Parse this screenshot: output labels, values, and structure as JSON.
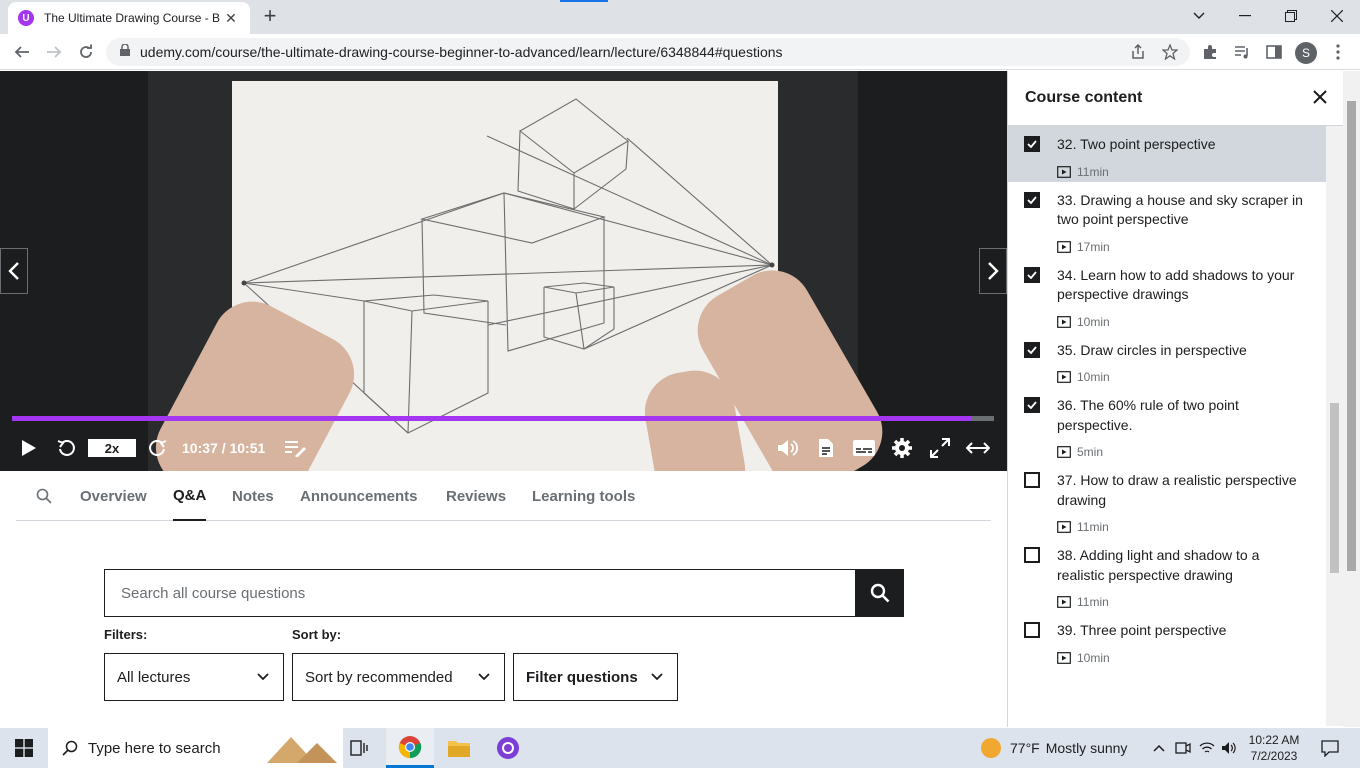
{
  "browser": {
    "tab_title": "The Ultimate Drawing Course - B",
    "url": "udemy.com/course/the-ultimate-drawing-course-beginner-to-advanced/learn/lecture/6348844#questions",
    "avatar_letter": "S",
    "favicon_letter": "U"
  },
  "player": {
    "speed": "2x",
    "time": "10:37 / 10:51",
    "progress": 0.977,
    "accent": "#a435f0"
  },
  "tabs": [
    "Overview",
    "Q&A",
    "Notes",
    "Announcements",
    "Reviews",
    "Learning tools"
  ],
  "active_tab": "Q&A",
  "qa": {
    "search_placeholder": "Search all course questions",
    "filters_label": "Filters:",
    "sort_label": "Sort by:",
    "filter_value": "All lectures",
    "sort_value": "Sort by recommended",
    "filter_questions": "Filter questions"
  },
  "sidebar": {
    "title": "Course content",
    "lectures": [
      {
        "title": "32. Two point perspective",
        "duration": "11min",
        "checked": true,
        "current": true
      },
      {
        "title": "33. Drawing a house and sky scraper in two point perspective",
        "duration": "17min",
        "checked": true,
        "current": false
      },
      {
        "title": "34. Learn how to add shadows to your perspective drawings",
        "duration": "10min",
        "checked": true,
        "current": false
      },
      {
        "title": "35. Draw circles in perspective",
        "duration": "10min",
        "checked": true,
        "current": false
      },
      {
        "title": "36. The 60% rule of two point perspective.",
        "duration": "5min",
        "checked": true,
        "current": false
      },
      {
        "title": "37. How to draw a realistic perspective drawing",
        "duration": "11min",
        "checked": false,
        "current": false
      },
      {
        "title": "38. Adding light and shadow to a realistic perspective drawing",
        "duration": "11min",
        "checked": false,
        "current": false
      },
      {
        "title": "39. Three point perspective",
        "duration": "10min",
        "checked": false,
        "current": false
      }
    ]
  },
  "taskbar": {
    "search_placeholder": "Type here to search",
    "temperature": "77°F",
    "weather": "Mostly sunny",
    "time": "10:22 AM",
    "date": "7/2/2023"
  }
}
